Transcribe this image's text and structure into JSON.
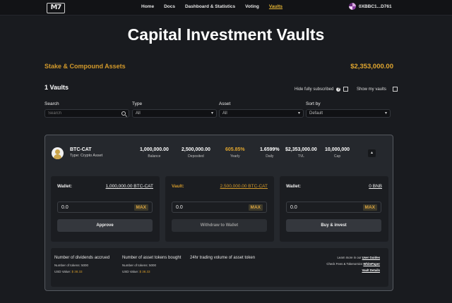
{
  "header": {
    "logo": "M7",
    "nav": [
      "Home",
      "Docs",
      "Dashboard & Statistics",
      "Voting",
      "Vaults"
    ],
    "active_nav": "Vaults",
    "wallet_address": "0XBBC1...D761"
  },
  "page": {
    "title": "Capital Investment Vaults",
    "stake_label": "Stake & Compound Assets",
    "total_value": "$2,353,000.00",
    "vault_count": "1 Vaults",
    "hide_fully_subscribed": "Hide fully subscribed",
    "show_my_vaults": "Show my vaults"
  },
  "filters": {
    "search_label": "Search",
    "search_placeholder": "Search",
    "type_label": "Type",
    "type_value": "All",
    "asset_label": "Asset",
    "asset_value": "All",
    "sort_label": "Sort by",
    "sort_value": "Default"
  },
  "vault": {
    "name": "BTC-CAT",
    "type": "Type: Crypto Asset",
    "stats": [
      {
        "value": "1,000,000.00",
        "label": "Balance"
      },
      {
        "value": "2,500,000.00",
        "label": "Deposited"
      },
      {
        "value": "605.85%",
        "label": "Yearly"
      },
      {
        "value": "1.6599%",
        "label": "Daily"
      },
      {
        "value": "$2,353,000.00",
        "label": "TVL"
      },
      {
        "value": "10,000,000",
        "label": "Cap"
      }
    ],
    "panels": [
      {
        "label": "Wallet:",
        "value": "1,000,000.00 BTC-CAT",
        "amount": "0.0",
        "max": "MAX",
        "action": "Approve"
      },
      {
        "label": "Vault:",
        "value": "2,500,000.00 BTC-CAT",
        "amount": "0.0",
        "max": "MAX",
        "action": "Withdraw to Wallet"
      },
      {
        "label": "Wallet:",
        "value": "0 BNB",
        "amount": "0.0",
        "max": "MAX",
        "action": "Buy & invest"
      }
    ],
    "info": {
      "dividends_title": "Number of dividends accrued",
      "dividends_tokens": "Number of tokens: 5000",
      "dividends_usd_label": "USD Value:",
      "dividends_usd_value": "$ 38.33",
      "bought_title": "Number of asset tokens bought",
      "bought_tokens": "Number of tokens: 5000",
      "bought_usd_label": "USD Value:",
      "bought_usd_value": "$ 38.33",
      "volume_title": "24hr trading volume of asset token",
      "learn_more_text": "Learn more in our",
      "learn_more_link": "User Guides",
      "check_text": "Check Fees & Tokenomics",
      "check_link": "WhitePaper",
      "vault_details_link": "Vault Details"
    }
  }
}
